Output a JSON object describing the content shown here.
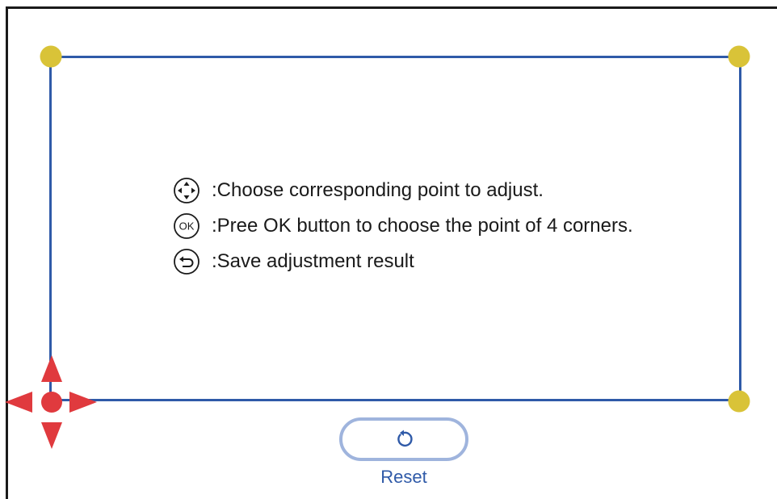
{
  "instructions": {
    "move": ":Choose corresponding point to adjust.",
    "ok": ":Pree OK button to choose the point of 4 corners.",
    "back": ":Save adjustment result"
  },
  "ok_icon_text": "OK",
  "reset": {
    "label": "Reset"
  },
  "colors": {
    "frame": "#2f5aa8",
    "corner": "#d9c338",
    "active_corner": "#e03a3e",
    "reset_border": "#9fb4dd"
  },
  "icons": {
    "move": "direction-pad-icon",
    "ok": "ok-button-icon",
    "back": "back-arrow-icon",
    "reset": "rotate-icon",
    "active": "move-arrows-icon"
  }
}
